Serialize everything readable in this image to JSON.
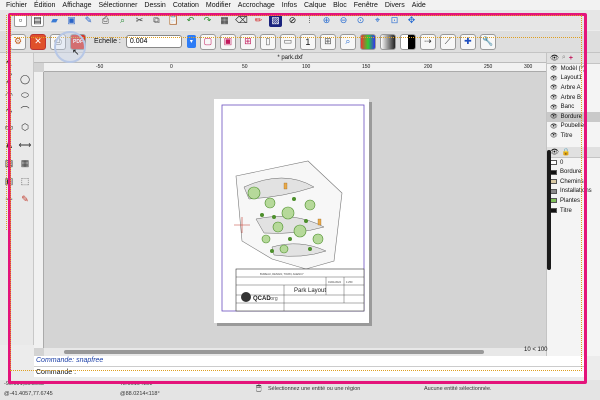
{
  "menu": [
    "Fichier",
    "Édition",
    "Affichage",
    "Sélectionner",
    "Dessin",
    "Cotation",
    "Modifier",
    "Accrochage",
    "Infos",
    "Calque",
    "Bloc",
    "Fenêtre",
    "Divers",
    "Aide"
  ],
  "options": {
    "scale_label": "Echelle :",
    "scale_value": "0.004",
    "pdf_label": "PDF",
    "page_number": "1"
  },
  "document": {
    "tab_title": "* park.dxf",
    "ruler_h_labels": [
      "-50",
      "0",
      "50",
      "100",
      "150",
      "200",
      "250",
      "300"
    ]
  },
  "drawing": {
    "company_name": "QCAD",
    "company_suffix": ".org",
    "title": "Park Layout",
    "scale_text": "1:250",
    "date_text": "01/01/2024",
    "row1_text": "BUREAU, DESIGN, TOWN, AGENCY"
  },
  "command": {
    "log_text": "Commande: snapfree",
    "prompt_label": "Commande :"
  },
  "status": {
    "abs_coord": "-90.591,55.8668",
    "rel_coord": "@-41.4057,77.6745",
    "polar_coord": "72.0019<151°",
    "rel_polar": "@88.0214<118°",
    "hint": "Sélectionnez une entité ou une région",
    "selection": "Aucune entité sélectionnée.",
    "zoom": "10 < 100"
  },
  "blocks": {
    "items": [
      {
        "name": "Modèl (*)",
        "selected": false
      },
      {
        "name": "Layout1 (",
        "selected": false
      },
      {
        "name": "Arbre A",
        "selected": false
      },
      {
        "name": "Arbre B",
        "selected": false
      },
      {
        "name": "Banc",
        "selected": false
      },
      {
        "name": "Bordure",
        "selected": true
      },
      {
        "name": "Poubelle",
        "selected": false
      },
      {
        "name": "Titre",
        "selected": false
      }
    ]
  },
  "layers": {
    "items": [
      {
        "name": "0",
        "color": "#ffffff"
      },
      {
        "name": "Bordure",
        "color": "#111111"
      },
      {
        "name": "Chemins",
        "color": "#d9c9a3"
      },
      {
        "name": "Installations",
        "color": "#8a8a8a"
      },
      {
        "name": "Plantes",
        "color": "#7fbf5a"
      },
      {
        "name": "Titre",
        "color": "#111111"
      }
    ]
  },
  "colors": {
    "highlight": "#e4147b",
    "trace": "#e0a020",
    "tree_green": "#4d8f2c",
    "path_fill": "#e2e2e2"
  }
}
